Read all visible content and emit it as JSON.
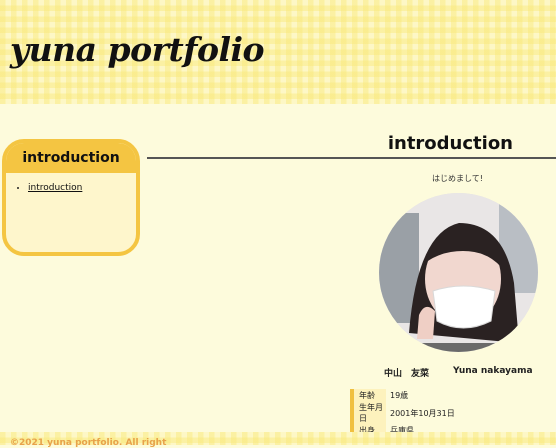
{
  "header": {
    "logo_text": "yuna portfolio"
  },
  "sidebar": {
    "heading": "introduction",
    "items": [
      {
        "label": "introduction"
      }
    ]
  },
  "main": {
    "title": "introduction",
    "greeting": "はじめまして!",
    "name_ja": "中山　友菜",
    "name_en": "Yuna nakayama",
    "profile": [
      {
        "label": "年齢",
        "value": "19歳"
      },
      {
        "label": "生年月日",
        "value": "2001年10月31日"
      },
      {
        "label": "出身",
        "value": "兵庫県"
      }
    ]
  },
  "footer": {
    "copyright": "©2021 yuna portfolio. All right"
  },
  "colors": {
    "accent": "#f4c542",
    "background": "#fdfbdc",
    "copyright": "#e7a24a"
  }
}
